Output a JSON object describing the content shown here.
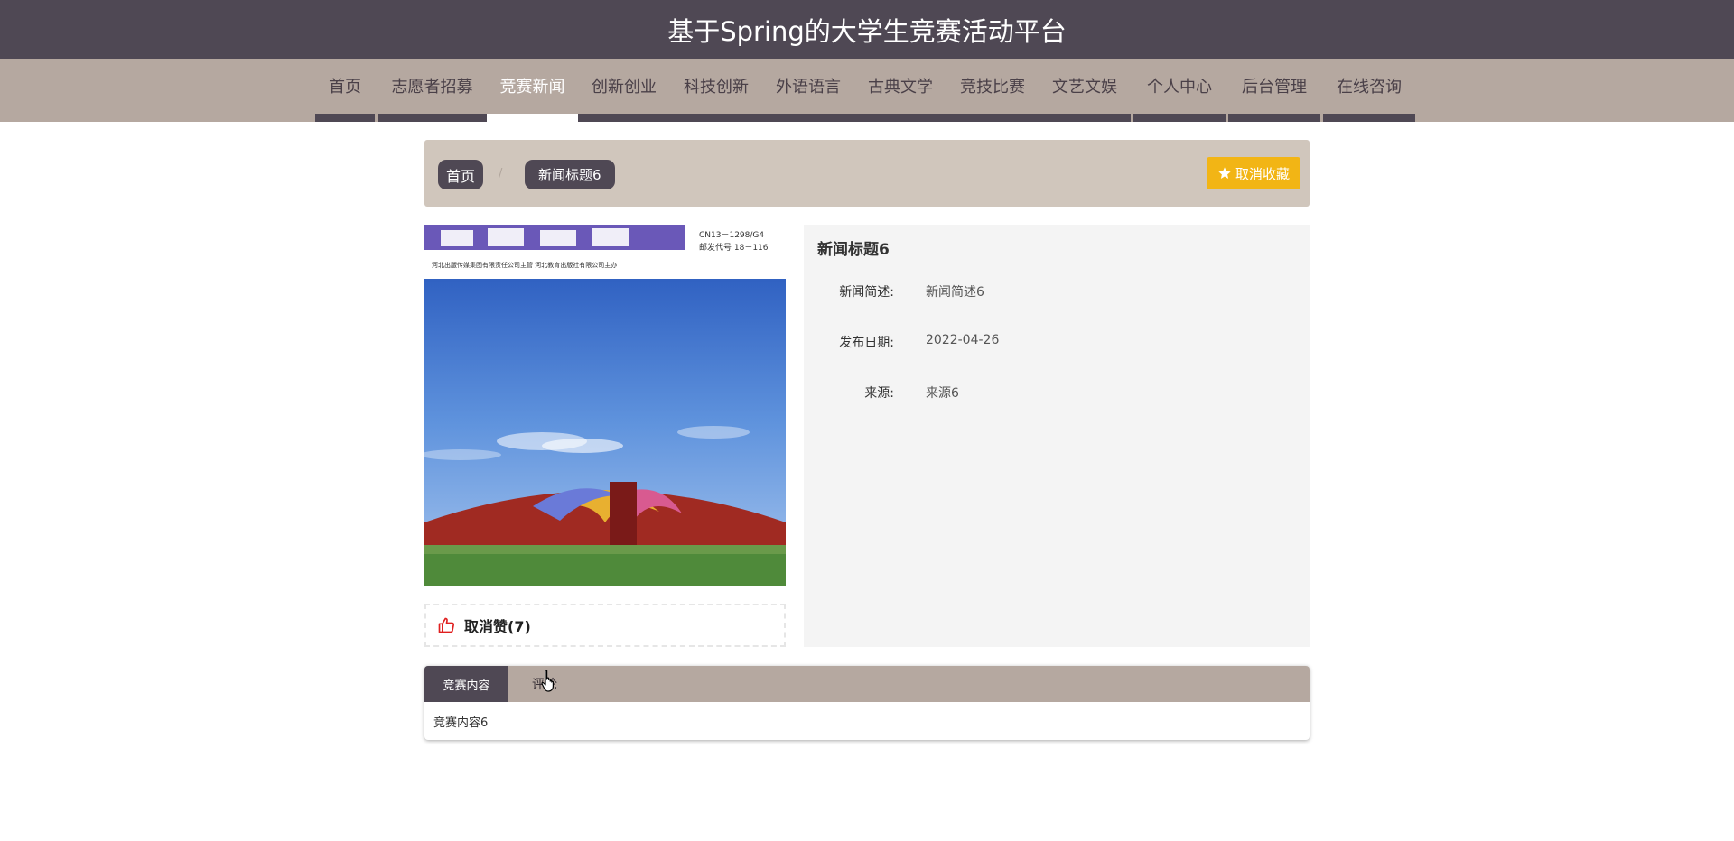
{
  "header": {
    "title": "基于Spring的大学生竞赛活动平台"
  },
  "nav": {
    "items": [
      {
        "label": "首页"
      },
      {
        "label": "志愿者招募"
      },
      {
        "label": "竞赛新闻",
        "active": true
      },
      {
        "label": "创新创业"
      },
      {
        "label": "科技创新"
      },
      {
        "label": "外语语言"
      },
      {
        "label": "古典文学"
      },
      {
        "label": "竞技比赛"
      },
      {
        "label": "文艺文娱"
      },
      {
        "label": "个人中心"
      },
      {
        "label": "后台管理"
      },
      {
        "label": "在线咨询"
      }
    ]
  },
  "breadcrumb": {
    "home": "首页",
    "separator": "/",
    "current": "新闻标题6"
  },
  "favorite": {
    "label": "取消收藏",
    "icon": "star-icon",
    "color": "#f2b515"
  },
  "cover": {
    "masthead_small_1": "CN13－1298/G4",
    "masthead_small_2": "邮发代号 18－116",
    "masthead_line": "河北出版传媒集团有限责任公司主管    河北教育出版社有限公司主办"
  },
  "like": {
    "label": "取消赞(7)",
    "icon": "thumb-up-icon",
    "color": "#e02020"
  },
  "detail": {
    "title": "新闻标题6",
    "rows": [
      {
        "key": "新闻简述:",
        "value": "新闻简述6"
      },
      {
        "key": "发布日期:",
        "value": "2022-04-26"
      },
      {
        "key": "来源:",
        "value": "来源6"
      }
    ]
  },
  "tabs": {
    "items": [
      {
        "label": "竞赛内容",
        "active": true
      },
      {
        "label": "评论"
      }
    ],
    "content": "竞赛内容6"
  },
  "colors": {
    "header_bg": "#4f4854",
    "nav_bg": "#b5a8a0",
    "breadcrumb_bg": "#d0c6bc",
    "accent": "#4f4854"
  }
}
